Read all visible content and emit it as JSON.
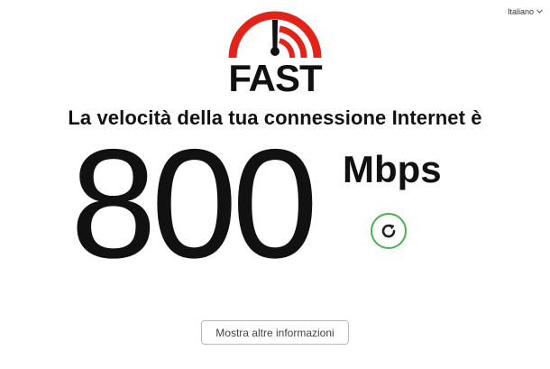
{
  "header": {
    "language_label": "Italiano",
    "language_chevron_icon": "chevron-down-icon"
  },
  "logo": {
    "text": "FAST",
    "gauge_icon": "speedometer-icon",
    "brand_color": "#e2231a"
  },
  "main": {
    "headline": "La velocità della tua connessione Internet è",
    "speed_value": "800",
    "speed_unit": "Mbps",
    "reload_icon": "refresh-icon",
    "reload_color": "#4caf50",
    "more_info_label": "Mostra altre informazioni"
  }
}
